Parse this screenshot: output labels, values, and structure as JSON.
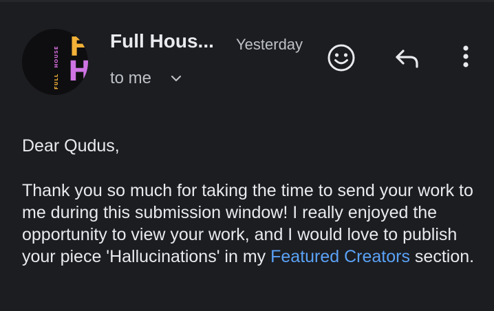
{
  "avatar": {
    "letter_top": "F",
    "letter_bottom": "H",
    "side_word_1": "FULL",
    "side_word_2": "HOUSE",
    "color_top": "#f2b137",
    "color_bottom": "#cf74e4"
  },
  "header": {
    "sender": "Full Hous...",
    "date": "Yesterday",
    "recipient": "to me",
    "icons": [
      "chevron-down-icon",
      "add-reaction-icon",
      "reply-icon",
      "more-vert-icon"
    ]
  },
  "message": {
    "greeting": "Dear Qudus,",
    "para_before_link": "Thank you so much for taking the time to send your work to me during this submission window! I really enjoyed the opportunity to view your work, and I would love to publish your piece 'Hallucinations' in my ",
    "link_text": "Featured Creators",
    "para_after_link": " section.",
    "link_color": "#5aa2f7"
  }
}
